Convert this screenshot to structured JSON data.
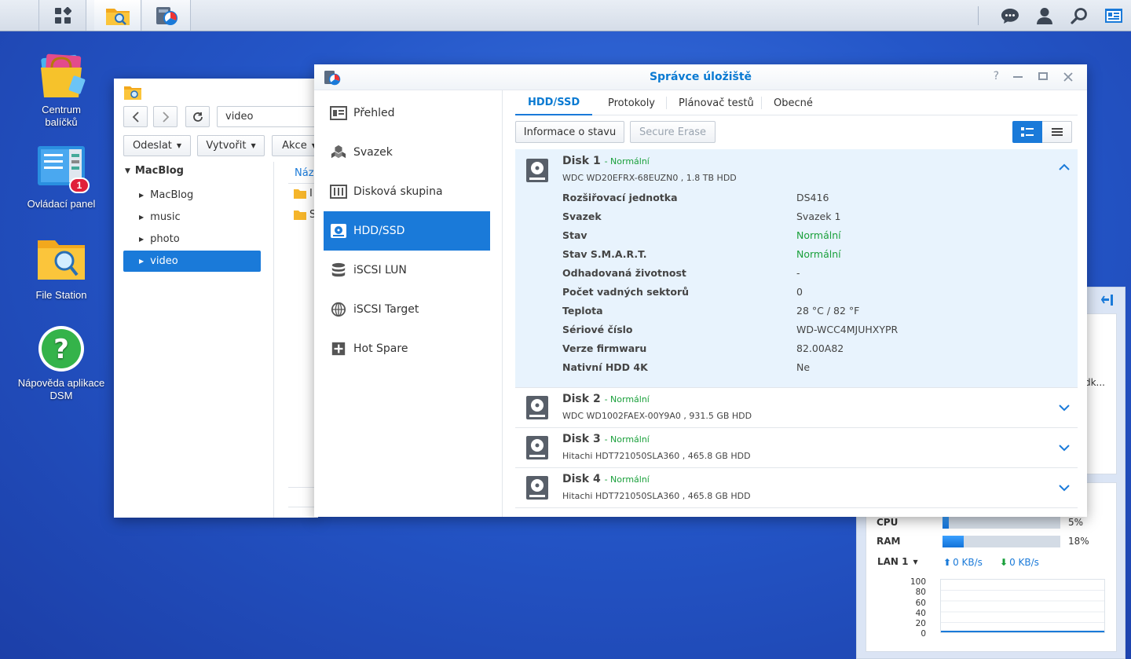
{
  "taskbar": {
    "left_icons": [
      "main-menu-icon",
      "file-station-icon",
      "storage-manager-icon"
    ],
    "right_icons": [
      "chat-icon",
      "user-icon",
      "search-icon",
      "widgets-icon"
    ]
  },
  "desktop": {
    "icons": [
      {
        "label": "Centrum balíčků",
        "badge": ""
      },
      {
        "label": "Ovládací panel",
        "badge": "1"
      },
      {
        "label": "File Station",
        "badge": ""
      },
      {
        "label": "Nápověda aplikace DSM",
        "badge": ""
      }
    ]
  },
  "file_station": {
    "path_value": "video",
    "toolbar": {
      "upload": "Odeslat",
      "create": "Vytvořit",
      "action": "Akce"
    },
    "column_header": "Náze",
    "tree_root": "MacBlog",
    "tree_items": [
      "MacBlog",
      "music",
      "photo",
      "video"
    ],
    "selected_item": "video",
    "list_rows": [
      "I",
      "S"
    ]
  },
  "storage_manager": {
    "title": "Správce úložiště",
    "nav": [
      "Přehled",
      "Svazek",
      "Disková skupina",
      "HDD/SSD",
      "iSCSI LUN",
      "iSCSI Target",
      "Hot Spare"
    ],
    "selected_nav": "HDD/SSD",
    "tabs": [
      "HDD/SSD",
      "Protokoly",
      "Plánovač testů",
      "Obecné"
    ],
    "actions": {
      "info": "Informace o stavu",
      "erase": "Secure Erase"
    },
    "disks": [
      {
        "name": "Disk 1",
        "status": "- Normální",
        "model": "WDC WD20EFRX-68EUZN0 , 1.8 TB HDD",
        "expanded": true
      },
      {
        "name": "Disk 2",
        "status": "- Normální",
        "model": "WDC WD1002FAEX-00Y9A0 , 931.5 GB HDD",
        "expanded": false
      },
      {
        "name": "Disk 3",
        "status": "- Normální",
        "model": "Hitachi HDT721050SLA360 , 465.8 GB HDD",
        "expanded": false
      },
      {
        "name": "Disk 4",
        "status": "- Normální",
        "model": "Hitachi HDT721050SLA360 , 465.8 GB HDD",
        "expanded": false
      }
    ],
    "disk1_details": [
      {
        "k": "Rozšiřovací jednotka",
        "v": "DS416",
        "green": false
      },
      {
        "k": "Svazek",
        "v": "Svazek 1",
        "green": false
      },
      {
        "k": "Stav",
        "v": "Normální",
        "green": true
      },
      {
        "k": "Stav S.M.A.R.T.",
        "v": "Normální",
        "green": true
      },
      {
        "k": "Odhadovaná životnost",
        "v": "-",
        "green": false
      },
      {
        "k": "Počet vadných sektorů",
        "v": "0",
        "green": false
      },
      {
        "k": "Teplota",
        "v": "28 °C / 82 °F",
        "green": false
      },
      {
        "k": "Sériové číslo",
        "v": "WD-WCC4MJUHXYPR",
        "green": false
      },
      {
        "k": "Verze firmwaru",
        "v": "82.00A82",
        "green": false
      },
      {
        "k": "Nativní HDD 4K",
        "v": "Ne",
        "green": false
      }
    ]
  },
  "widget": {
    "truncated_text": "dk...",
    "cpu_label": "CPU",
    "cpu_percent": 5,
    "cpu_text": "5%",
    "ram_label": "RAM",
    "ram_percent": 18,
    "ram_text": "18%",
    "lan_label": "LAN 1",
    "upload": "0 KB/s",
    "download": "0 KB/s",
    "y_ticks": [
      "100",
      "80",
      "60",
      "40",
      "20",
      "0"
    ]
  },
  "colors": {
    "accent": "#1a7ad9",
    "status_green": "#1aa03b",
    "title_blue": "#0a7ad2",
    "badge_red": "#e0203a"
  }
}
